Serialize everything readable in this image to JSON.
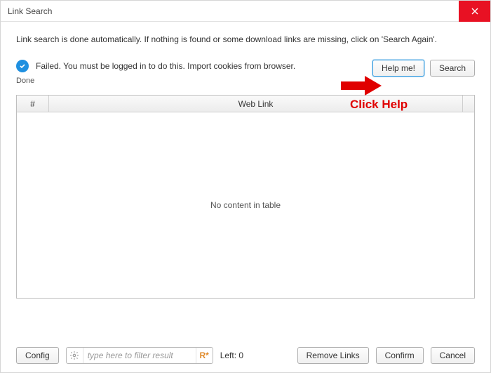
{
  "window": {
    "title": "Link Search"
  },
  "intro": "Link search is done automatically. If nothing is found or some download links are missing, click on 'Search Again'.",
  "status": {
    "message": "Failed. You must be logged in to do this. Import cookies from browser.",
    "done_label": "Done"
  },
  "buttons": {
    "help": "Help me!",
    "search": "Search",
    "config": "Config",
    "remove_links": "Remove Links",
    "confirm": "Confirm",
    "cancel": "Cancel"
  },
  "table": {
    "col_num": "#",
    "col_link": "Web Link",
    "empty": "No content in table"
  },
  "filter": {
    "placeholder": "type here to filter result",
    "regex_badge": "R*"
  },
  "left_label": "Left: 0",
  "annotation": {
    "label": "Click Help"
  }
}
